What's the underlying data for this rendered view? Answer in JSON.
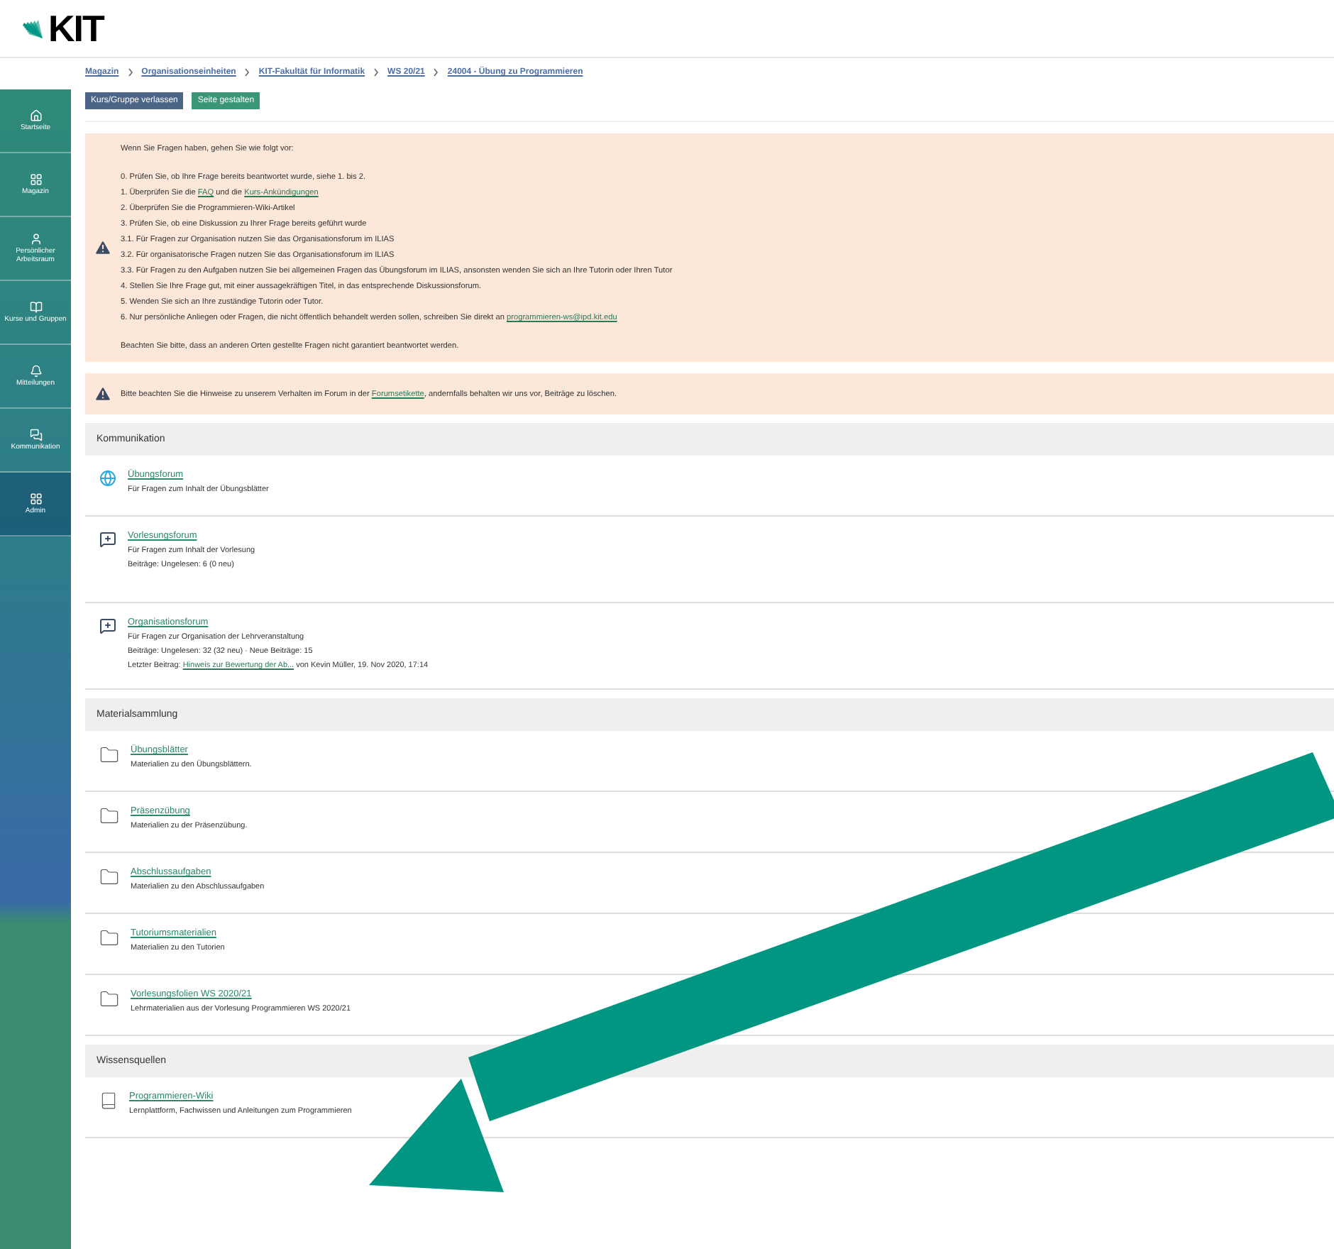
{
  "header": {
    "logo": "KIT"
  },
  "breadcrumbs": [
    "Magazin",
    "Organisationseinheiten",
    "KIT-Fakultät für Informatik",
    "WS 20/21",
    "24004 - Übung zu Programmieren"
  ],
  "actions": [
    {
      "label": "Kurs/Gruppe verlassen",
      "kind": "primary"
    },
    {
      "label": "Seite gestalten",
      "kind": "success"
    }
  ],
  "sidebar": {
    "items": [
      {
        "label": "Startseite",
        "kind": "home",
        "selected": false
      },
      {
        "label": "Magazin",
        "kind": "grid",
        "selected": false
      },
      {
        "label": "Persönlicher Arbeitsraum",
        "kind": "user",
        "selected": false
      },
      {
        "label": "Kurse und Gruppen",
        "kind": "book",
        "selected": false
      },
      {
        "label": "Mitteilungen",
        "kind": "bell",
        "selected": false
      },
      {
        "label": "Kommunikation",
        "kind": "chat",
        "selected": false
      },
      {
        "label": "Admin",
        "kind": "grid",
        "selected": true
      }
    ]
  },
  "notice": {
    "intro": "Wenn Sie Fragen haben, gehen Sie wie folgt vor:",
    "lines": [
      [
        {
          "text": "0. Prüfen Sie, ob Ihre Frage bereits beantwortet wurde, siehe 1. bis 2."
        }
      ],
      [
        {
          "text": "1. Überprüfen Sie die "
        },
        {
          "link": "FAQ"
        },
        {
          "text": " und die "
        },
        {
          "link": "Kurs-Ankündigungen"
        }
      ],
      [
        {
          "text": "2. Überprüfen Sie die Programmieren-Wiki-Artikel"
        }
      ],
      [
        {
          "text": "3. Prüfen Sie, ob eine Diskussion zu Ihrer Frage bereits geführt wurde"
        }
      ],
      [
        {
          "text": "3.1. Für Fragen zur Organisation nutzen Sie das Organisationsforum im ILIAS"
        }
      ],
      [
        {
          "text": "3.2. Für organisatorische Fragen nutzen Sie das Organisationsforum im ILIAS"
        }
      ],
      [
        {
          "text": "3.3. Für Fragen zu den Aufgaben nutzen Sie bei allgemeinen Fragen das Übungsforum im ILIAS, ansonsten wenden Sie sich an Ihre Tutorin oder Ihren Tutor"
        }
      ],
      [
        {
          "text": "4. Stellen Sie Ihre Frage gut, mit einer aussagekräftigen Titel, in das entsprechende Diskussionsforum."
        }
      ],
      [
        {
          "text": "5. Wenden Sie sich an Ihre zuständige Tutorin oder Tutor."
        }
      ],
      [
        {
          "text": "6. Nur persönliche Anliegen oder Fragen, die nicht öffentlich behandelt werden sollen, schreiben Sie direkt an "
        },
        {
          "link": "programmieren-ws@ipd.kit.edu"
        }
      ]
    ],
    "outro": "Beachten Sie bitte, dass an anderen Orten gestellte Fragen nicht garantiert beantwortet werden."
  },
  "notice2": [
    {
      "text": "Bitte beachten Sie die Hinweise zu unserem Verhalten im Forum in der "
    },
    {
      "link": "Forumsetikette"
    },
    {
      "text": ", andernfalls behalten wir uns vor, Beiträge zu löschen."
    }
  ],
  "sections": [
    {
      "title": "Kommunikation",
      "items": [
        {
          "kind": "globe",
          "title": "Übungsforum",
          "lines": [
            [
              {
                "text": "Für Fragen zum Inhalt der Übungsblätter"
              }
            ]
          ]
        },
        {
          "kind": "forum",
          "title": "Vorlesungsforum",
          "lines": [
            [
              {
                "text": "Für Fragen zum Inhalt der Vorlesung"
              }
            ],
            [
              {
                "text": "Beiträge: Ungelesen: 6 (0 neu)"
              }
            ]
          ]
        },
        {
          "kind": "forum",
          "title": "Organisationsforum",
          "lines": [
            [
              {
                "text": "Für Fragen zur Organisation der Lehrveranstaltung"
              }
            ],
            [
              {
                "text": "Beiträge: Ungelesen: 32 (32 neu) · Neue Beiträge: 15"
              }
            ],
            [
              {
                "text": "Letzter Beitrag: "
              },
              {
                "link": "Hinweis zur Bewertung der Ab..."
              },
              {
                "text": " von Kevin Müller, 19. Nov 2020, 17:14"
              }
            ]
          ]
        }
      ]
    },
    {
      "title": "Materialsammlung",
      "items": [
        {
          "kind": "folder",
          "title": "Übungsblätter",
          "lines": [
            [
              {
                "text": "Materialien zu den Übungsblättern."
              }
            ]
          ]
        },
        {
          "kind": "folder",
          "title": "Präsenzübung",
          "lines": [
            [
              {
                "text": "Materialien zu der Präsenzübung."
              }
            ]
          ]
        },
        {
          "kind": "folder",
          "title": "Abschlussaufgaben",
          "lines": [
            [
              {
                "text": "Materialien zu den Abschlussaufgaben"
              }
            ]
          ]
        },
        {
          "kind": "folder",
          "title": "Tutoriumsmaterialien",
          "lines": [
            [
              {
                "text": "Materialien zu den Tutorien"
              }
            ]
          ]
        },
        {
          "kind": "folder",
          "title": "Vorlesungsfolien WS 2020/21",
          "lines": [
            [
              {
                "text": "Lehrmaterialien aus der Vorlesung Programmieren WS 2020/21"
              }
            ]
          ]
        }
      ]
    },
    {
      "title": "Wissensquellen",
      "items": [
        {
          "kind": "wiki",
          "title": "Programmieren-Wiki",
          "lines": [
            [
              {
                "text": "Lernplattform, Fachwissen und Anleitungen zum Programmieren"
              }
            ]
          ]
        }
      ]
    }
  ]
}
